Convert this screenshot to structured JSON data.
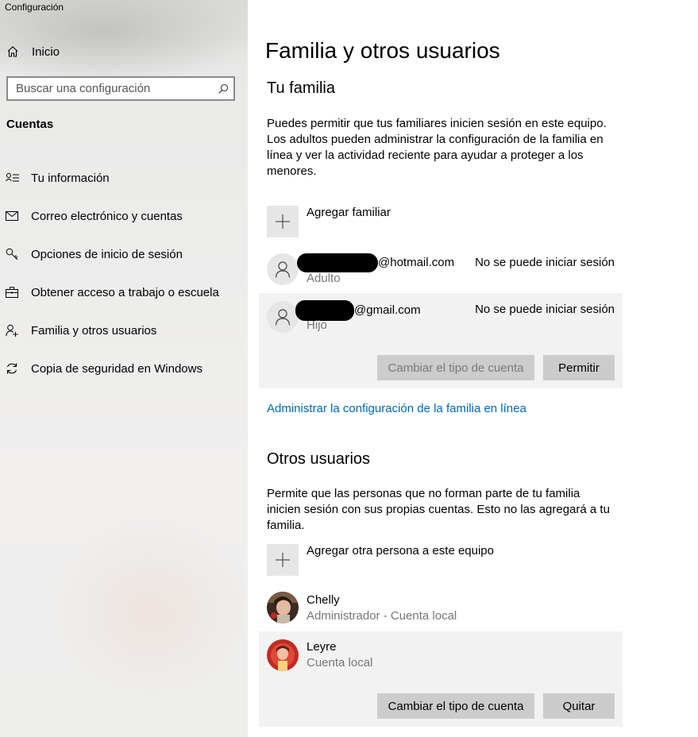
{
  "window": {
    "title": "Configuración"
  },
  "sidebar": {
    "home_label": "Inicio",
    "search_placeholder": "Buscar una configuración",
    "section": "Cuentas",
    "items": [
      {
        "label": "Tu información",
        "icon": "person-card-icon"
      },
      {
        "label": "Correo electrónico y cuentas",
        "icon": "mail-icon"
      },
      {
        "label": "Opciones de inicio de sesión",
        "icon": "key-icon"
      },
      {
        "label": "Obtener acceso a trabajo o escuela",
        "icon": "briefcase-icon"
      },
      {
        "label": "Familia y otros usuarios",
        "icon": "person-add-icon"
      },
      {
        "label": "Copia de seguridad en Windows",
        "icon": "sync-icon"
      }
    ]
  },
  "main": {
    "title": "Familia y otros usuarios",
    "family": {
      "heading": "Tu familia",
      "description": "Puedes permitir que tus familiares inicien sesión en este equipo. Los adultos pueden administrar la configuración de la familia en línea y ver la actividad reciente para ayudar a proteger a los menores.",
      "add_label": "Agregar familiar",
      "members": [
        {
          "email_suffix": "@hotmail.com",
          "role": "Adulto",
          "status": "No se puede iniciar sesión"
        },
        {
          "email_suffix": "@gmail.com",
          "role": "Hijo",
          "status": "No se puede iniciar sesión"
        }
      ],
      "change_type_button": "Cambiar el tipo de cuenta",
      "allow_button": "Permitir",
      "manage_link": "Administrar la configuración de la familia en línea"
    },
    "others": {
      "heading": "Otros usuarios",
      "description": "Permite que las personas que no forman parte de tu familia inicien sesión con sus propias cuentas. Esto no las agregará a tu familia.",
      "add_label": "Agregar otra persona a este equipo",
      "users": [
        {
          "name": "Chelly",
          "type": "Administrador - Cuenta local"
        },
        {
          "name": "Leyre",
          "type": "Cuenta local"
        }
      ],
      "change_type_button": "Cambiar el tipo de cuenta",
      "remove_button": "Quitar"
    }
  },
  "colors": {
    "link": "#0067b8",
    "button": "#cccccc",
    "selected_row": "#f2f2f2"
  }
}
